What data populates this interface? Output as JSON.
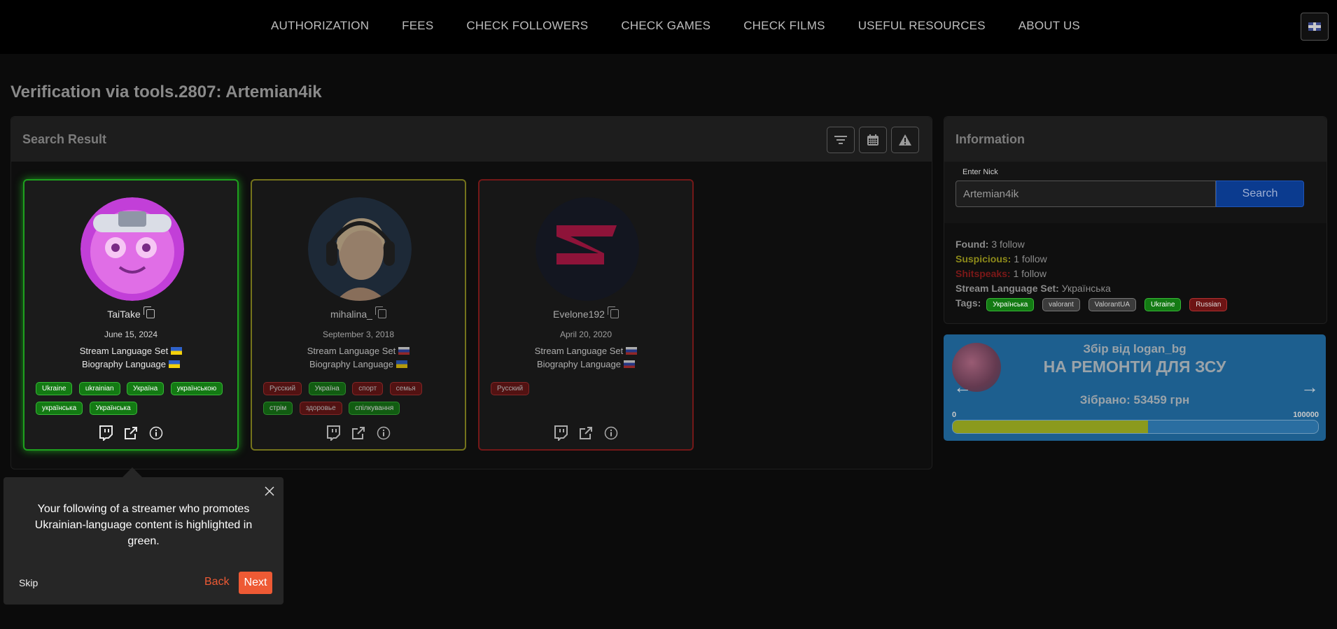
{
  "nav": {
    "items": [
      "AUTHORIZATION",
      "FEES",
      "CHECK FOLLOWERS",
      "CHECK GAMES",
      "CHECK FILMS",
      "USEFUL RESOURCES",
      "ABOUT US"
    ],
    "lang_icon": "uk-flag-icon"
  },
  "page_title": "Verification via tools.2807: Artemian4ik",
  "search_result": {
    "title": "Search Result",
    "tools": [
      "filter-icon",
      "calendar-icon",
      "warning-icon"
    ],
    "cards": [
      {
        "nick": "TaiTake",
        "date": "June 15, 2024",
        "stream_language_label": "Stream Language Set",
        "biography_language_label": "Biography Language",
        "stream_flag": "ua",
        "bio_flag": "ua",
        "status": "green",
        "tags": [
          "Ukraine",
          "ukrainian",
          "Україна",
          "українською",
          "українська",
          "Українська"
        ]
      },
      {
        "nick": "mihalina_",
        "date": "September 3, 2018",
        "stream_language_label": "Stream Language Set",
        "biography_language_label": "Biography Language",
        "stream_flag": "ru",
        "bio_flag": "ua",
        "status": "yellow",
        "tags": [
          "Русский",
          "Україна",
          "спорт",
          "семья",
          "стрім",
          "здоровье",
          "спілкування"
        ]
      },
      {
        "nick": "Evelone192",
        "date": "April 20, 2020",
        "stream_language_label": "Stream Language Set",
        "biography_language_label": "Biography Language",
        "stream_flag": "ru",
        "bio_flag": "ru",
        "status": "red",
        "tags": [
          "Русский"
        ]
      }
    ]
  },
  "information": {
    "title": "Information",
    "nick_label": "Enter Nick",
    "nick_value": "Artemian4ik",
    "search_label": "Search",
    "found_label": "Found:",
    "found_value": "3 follow",
    "suspicious_label": "Suspicious:",
    "suspicious_value": "1 follow",
    "shitspeaks_label": "Shitspeaks:",
    "shitspeaks_value": "1 follow",
    "stream_language_label": "Stream Language Set:",
    "stream_language_value": "Українська",
    "tags_label": "Tags:",
    "tags": [
      "Українська",
      "valorant",
      "ValorantUA",
      "Ukraine",
      "Russian"
    ]
  },
  "donation": {
    "line1": "Збір від logan_bg",
    "line2": "НА РЕМОНТИ ДЛЯ ЗСУ",
    "line3": "Зібрано: 53459 грн",
    "min": "0",
    "max": "100000",
    "progress_fraction": 0.53459,
    "prev_icon": "arrow-left-icon",
    "next_icon": "arrow-right-icon"
  },
  "tour": {
    "message": "Your following of a streamer who promotes Ukrainian-language content is highlighted in green.",
    "skip": "Skip",
    "back": "Back",
    "next": "Next"
  },
  "colors": {
    "green": "#1ea01e",
    "yellow": "#9c9a20",
    "red": "#9c1c1c",
    "accent": "#ee5a34",
    "search_button": "#0b3b8f"
  }
}
